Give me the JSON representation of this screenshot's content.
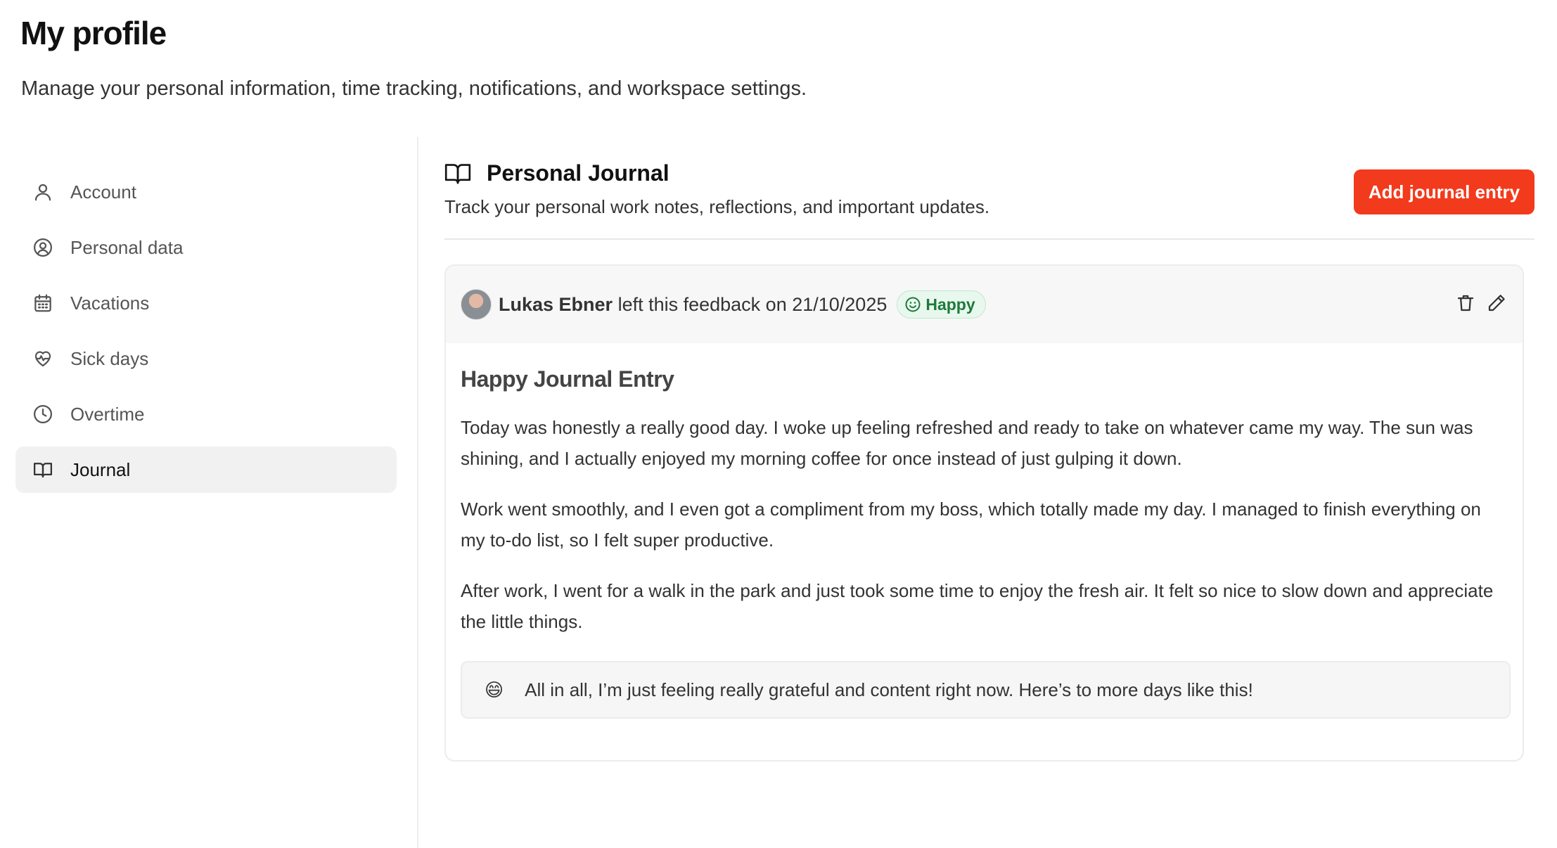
{
  "page": {
    "title": "My profile",
    "subtitle": "Manage your personal information, time tracking, notifications, and workspace settings."
  },
  "sidebar": {
    "items": [
      {
        "label": "Account",
        "icon": "user-icon",
        "active": false
      },
      {
        "label": "Personal data",
        "icon": "user-circle-icon",
        "active": false
      },
      {
        "label": "Vacations",
        "icon": "calendar-icon",
        "active": false
      },
      {
        "label": "Sick days",
        "icon": "heart-pulse-icon",
        "active": false
      },
      {
        "label": "Overtime",
        "icon": "clock-icon",
        "active": false
      },
      {
        "label": "Journal",
        "icon": "book-open-icon",
        "active": true
      }
    ]
  },
  "section": {
    "title": "Personal Journal",
    "description": "Track your personal work notes, reflections, and important updates.",
    "add_button_label": "Add journal entry"
  },
  "entry": {
    "author": "Lukas Ebner",
    "feedback_prefix": " left this feedback on ",
    "date": "21/10/2025",
    "mood": "Happy",
    "title": "Happy Journal Entry",
    "paragraphs": [
      "Today was honestly a really good day. I woke up feeling refreshed and ready to take on whatever came my way. The sun was shining, and I actually enjoyed my morning coffee for once instead of just gulping it down.",
      "Work went smoothly, and I even got a compliment from my boss, which totally made my day. I managed to finish everything on my to-do list, so I felt super productive.",
      "After work, I went for a walk in the park and just took some time to enjoy the fresh air. It felt so nice to slow down and appreciate the little things."
    ],
    "closing_emoji": "😄",
    "closing_note": "All in all, I’m just feeling really grateful and content right now. Here’s to more days like this!"
  },
  "colors": {
    "accent": "#f23a1c",
    "mood_bg": "#e8f8ee",
    "mood_text": "#1d7a3a"
  }
}
